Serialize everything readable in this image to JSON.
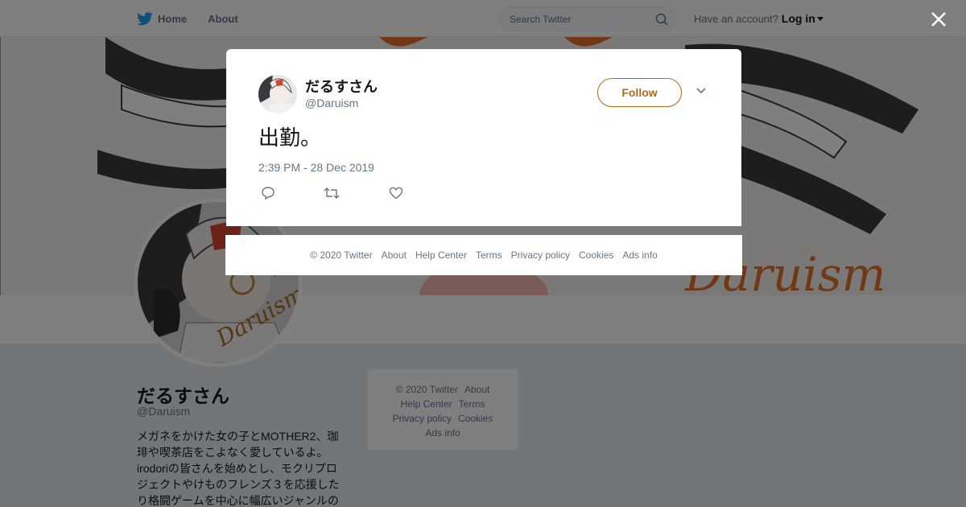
{
  "nav": {
    "home_label": "Home",
    "about_label": "About",
    "search_placeholder": "Search Twitter",
    "account_prompt": "Have an account?",
    "login_label": "Log in"
  },
  "banner": {
    "script_text": "Daruism"
  },
  "profile": {
    "name": "だるすさん",
    "handle": "@Daruism",
    "bio": "メガネをかけた女の子とMOTHER2、珈琲や喫茶店をこよなく愛しているよ。irodoriの皆さんを始めとし、モクリプロジェクトやけものフレンズ３を応援したり格闘ゲームを中心に幅広いジャンルの"
  },
  "sidebar_footer": {
    "copyright": "© 2020 Twitter",
    "about": "About",
    "help": "Help Center",
    "terms": "Terms",
    "privacy": "Privacy policy",
    "cookies": "Cookies",
    "ads": "Ads info"
  },
  "tweet": {
    "author_name": "だるすさん",
    "author_handle": "@Daruism",
    "follow_label": "Follow",
    "text": "出勤。",
    "timestamp": "2:39 PM - 28 Dec 2019"
  },
  "modal_footer": {
    "copyright": "© 2020 Twitter",
    "about": "About",
    "help": "Help Center",
    "terms": "Terms",
    "privacy": "Privacy policy",
    "cookies": "Cookies",
    "ads": "Ads info"
  },
  "colors": {
    "twitter_blue": "#1da1f2",
    "follow_accent": "#b06a19",
    "banner_accent": "#e0702a"
  },
  "icons": [
    "twitter-bird-icon",
    "search-icon",
    "close-icon",
    "chevron-down-icon",
    "reply-icon",
    "retweet-icon",
    "like-icon"
  ]
}
